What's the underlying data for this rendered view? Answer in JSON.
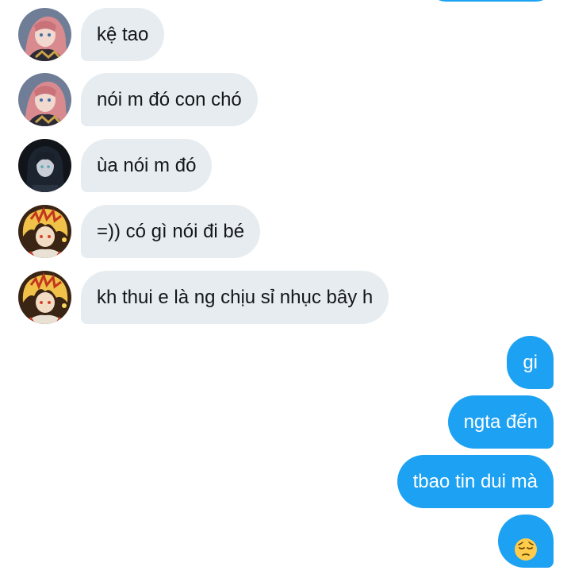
{
  "messages": [
    {
      "direction": "incoming",
      "avatar": "pink-hair-avatar",
      "text": "kệ tao"
    },
    {
      "direction": "incoming",
      "avatar": "pink-hair-avatar",
      "text": "nói m đó con chó"
    },
    {
      "direction": "incoming",
      "avatar": "dark-hair-avatar",
      "text": "ùa nói m đó"
    },
    {
      "direction": "incoming",
      "avatar": "flame-hair-avatar",
      "text": "=)) có gì nói đi bé"
    },
    {
      "direction": "incoming",
      "avatar": "flame-hair-avatar",
      "text": "kh thui e là ng chịu sỉ nhục bây h"
    },
    {
      "direction": "outgoing",
      "text": "gi"
    },
    {
      "direction": "outgoing",
      "text": "ngta đến"
    },
    {
      "direction": "outgoing",
      "text": "tbao tin dui mà"
    },
    {
      "direction": "outgoing",
      "emoji": "pensive-face-emoji"
    }
  ],
  "colors": {
    "incoming_bubble": "#e6ecf0",
    "outgoing_bubble": "#1da1f2",
    "incoming_text": "#14171a",
    "outgoing_text": "#ffffff"
  }
}
